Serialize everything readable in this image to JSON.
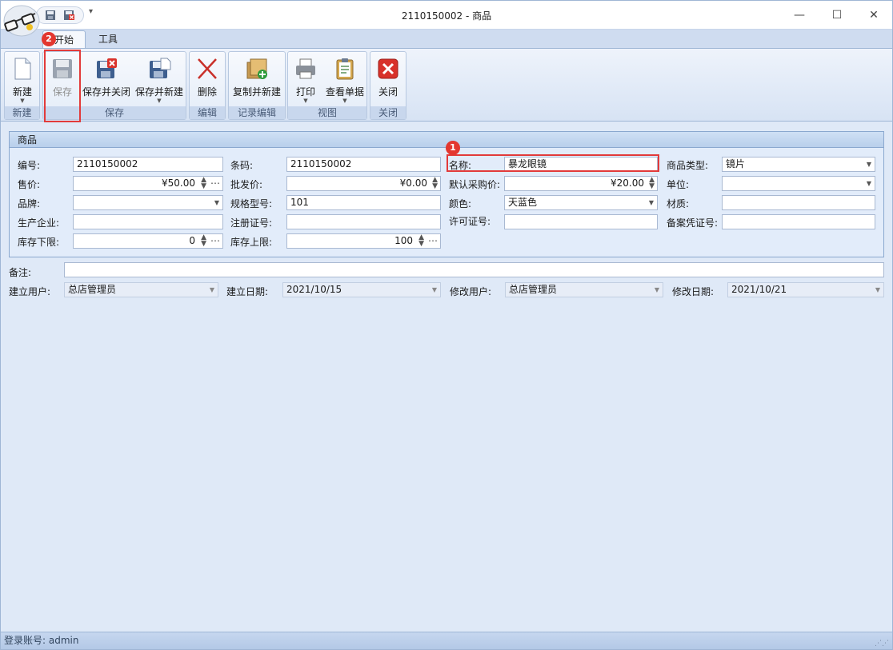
{
  "window": {
    "title": "2110150002 - 商品",
    "minimize": "—",
    "maximize": "☐",
    "close": "✕"
  },
  "quick_access": {
    "dropdown": "▾"
  },
  "tabs": [
    "开始",
    "工具"
  ],
  "ribbon": {
    "groups": [
      {
        "label": "新建",
        "buttons": [
          "新建"
        ]
      },
      {
        "label": "保存",
        "buttons": [
          "保存",
          "保存并关闭",
          "保存并新建"
        ]
      },
      {
        "label": "编辑",
        "buttons": [
          "删除"
        ]
      },
      {
        "label": "记录编辑",
        "buttons": [
          "复制并新建"
        ]
      },
      {
        "label": "视图",
        "buttons": [
          "打印",
          "查看单据"
        ]
      },
      {
        "label": "关闭",
        "buttons": [
          "关闭"
        ]
      }
    ]
  },
  "panel": {
    "title": "商品",
    "fields": {
      "code": {
        "label": "编号:",
        "value": "2110150002"
      },
      "barcode": {
        "label": "条码:",
        "value": "2110150002"
      },
      "name": {
        "label": "名称:",
        "value": "暴龙眼镜"
      },
      "product_type": {
        "label": "商品类型:",
        "value": "镜片"
      },
      "sale_price": {
        "label": "售价:",
        "value": "¥50.00"
      },
      "wholesale_price": {
        "label": "批发价:",
        "value": "¥0.00"
      },
      "default_purchase_price": {
        "label": "默认采购价:",
        "value": "¥20.00"
      },
      "unit": {
        "label": "单位:",
        "value": ""
      },
      "brand": {
        "label": "品牌:",
        "value": ""
      },
      "spec_model": {
        "label": "规格型号:",
        "value": "101"
      },
      "color": {
        "label": "颜色:",
        "value": "天蓝色"
      },
      "material": {
        "label": "材质:",
        "value": ""
      },
      "manufacturer": {
        "label": "生产企业:",
        "value": ""
      },
      "registration_no": {
        "label": "注册证号:",
        "value": ""
      },
      "license_no": {
        "label": "许可证号:",
        "value": ""
      },
      "filing_no": {
        "label": "备案凭证号:",
        "value": ""
      },
      "stock_min": {
        "label": "库存下限:",
        "value": "0"
      },
      "stock_max": {
        "label": "库存上限:",
        "value": "100"
      }
    }
  },
  "footer_fields": {
    "remark": {
      "label": "备注:",
      "value": ""
    },
    "created_by": {
      "label": "建立用户:",
      "value": "总店管理员"
    },
    "created_date": {
      "label": "建立日期:",
      "value": "2021/10/15"
    },
    "modified_by": {
      "label": "修改用户:",
      "value": "总店管理员"
    },
    "modified_date": {
      "label": "修改日期:",
      "value": "2021/10/21"
    }
  },
  "annotations": {
    "badge1": "1",
    "badge2": "2"
  },
  "status": {
    "login": "登录账号: admin"
  },
  "icons": {
    "app": "glasses-icon",
    "new": "new-document-icon",
    "save": "save-disk-icon",
    "save_close": "save-close-icon",
    "save_new": "save-new-icon",
    "delete": "delete-x-icon",
    "copy_new": "copy-new-icon",
    "print": "printer-icon",
    "view_doc": "clipboard-icon",
    "close": "close-red-icon"
  },
  "colors": {
    "highlight": "#e23a3a",
    "badge": "#e3372f",
    "ribbon": "#dfe9f7"
  }
}
